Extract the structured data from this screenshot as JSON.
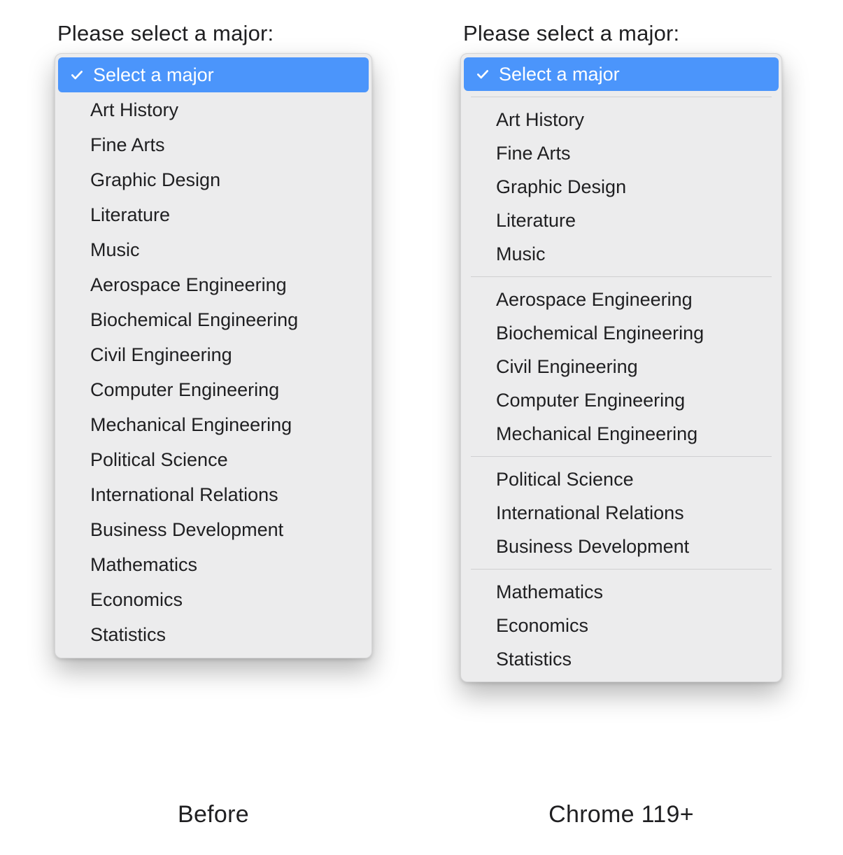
{
  "labels": {
    "left_title": "Please select a major:",
    "right_title": "Please select a major:",
    "left_caption": "Before",
    "right_caption": "Chrome 119+"
  },
  "selected_option": "Select a major",
  "left_menu": {
    "items": [
      "Select a major",
      "Art History",
      "Fine Arts",
      "Graphic Design",
      "Literature",
      "Music",
      "Aerospace Engineering",
      "Biochemical Engineering",
      "Civil Engineering",
      "Computer Engineering",
      "Mechanical Engineering",
      "Political Science",
      "International Relations",
      "Business Development",
      "Mathematics",
      "Economics",
      "Statistics"
    ]
  },
  "right_menu": {
    "header": "Select a major",
    "groups": [
      [
        "Art History",
        "Fine Arts",
        "Graphic Design",
        "Literature",
        "Music"
      ],
      [
        "Aerospace Engineering",
        "Biochemical Engineering",
        "Civil Engineering",
        "Computer Engineering",
        "Mechanical Engineering"
      ],
      [
        "Political Science",
        "International Relations",
        "Business Development"
      ],
      [
        "Mathematics",
        "Economics",
        "Statistics"
      ]
    ]
  }
}
